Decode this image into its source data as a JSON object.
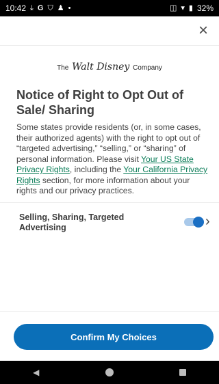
{
  "status_bar": {
    "time": "10:42",
    "left_icons": [
      "download-icon",
      "google-icon",
      "shield-icon",
      "person-icon",
      "dot-icon"
    ],
    "battery": "32%"
  },
  "header": {
    "close_icon": "×"
  },
  "logo": {
    "pre": "The",
    "script": "Walt Disney",
    "post": "Company"
  },
  "notice": {
    "title": "Notice of Right to Opt Out of Sale/ Sharing",
    "body_part1": "Some states provide residents (or, in some cases, their authorized agents) with the right to opt out of “targeted advertising,” “selling,” or “sharing” of personal information. Please visit ",
    "link_us": "Your US State Privacy Rights",
    "body_part2": ", including the ",
    "link_ca": "Your California Privacy Rights",
    "body_part3": " section, for more information about your rights and our privacy practices."
  },
  "preference": {
    "label": "Selling, Sharing, Targeted Advertising",
    "enabled": true
  },
  "confirm_button": {
    "label": "Confirm My Choices"
  },
  "colors": {
    "accent": "#0b6fb8",
    "link": "#0b7d58",
    "toggle": "#1a6fc4"
  }
}
